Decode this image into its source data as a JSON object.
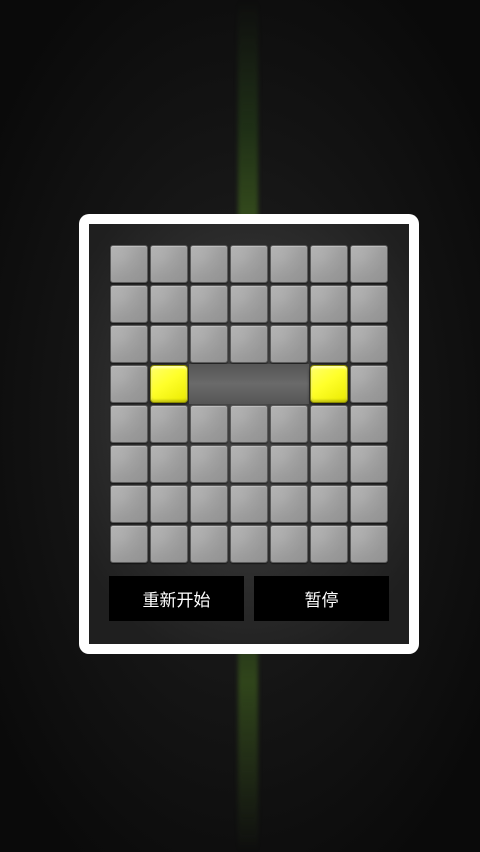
{
  "board": {
    "rows": 8,
    "cols": 7,
    "cells": [
      [
        "stone",
        "stone",
        "stone",
        "stone",
        "stone",
        "stone",
        "stone"
      ],
      [
        "stone",
        "stone",
        "stone",
        "stone",
        "stone",
        "stone",
        "stone"
      ],
      [
        "stone",
        "stone",
        "stone",
        "stone",
        "stone",
        "stone",
        "stone"
      ],
      [
        "stone",
        "tile",
        "empty",
        "empty",
        "empty",
        "tile",
        "stone"
      ],
      [
        "stone",
        "stone",
        "stone",
        "stone",
        "stone",
        "stone",
        "stone"
      ],
      [
        "stone",
        "stone",
        "stone",
        "stone",
        "stone",
        "stone",
        "stone"
      ],
      [
        "stone",
        "stone",
        "stone",
        "stone",
        "stone",
        "stone",
        "stone"
      ],
      [
        "stone",
        "stone",
        "stone",
        "stone",
        "stone",
        "stone",
        "stone"
      ]
    ],
    "tile_color": "#ffff33"
  },
  "buttons": {
    "restart_label": "重新开始",
    "pause_label": "暂停"
  }
}
